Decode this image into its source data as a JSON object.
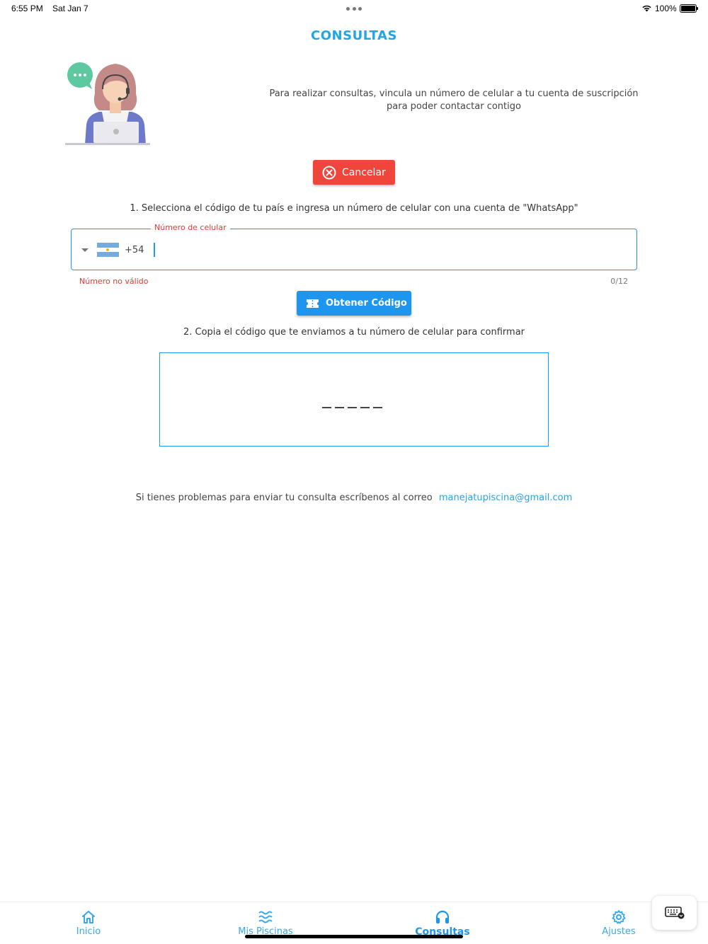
{
  "status_bar": {
    "time": "6:55 PM",
    "date": "Sat Jan 7",
    "battery": "100%"
  },
  "page": {
    "title": "CONSULTAS",
    "intro": "Para realizar consultas, vincula un número de celular a tu cuenta de suscripción para poder contactar contigo"
  },
  "cancel_button": {
    "label": "Cancelar",
    "color": "#f0453a"
  },
  "step1": "1. Selecciona el código de tu país e ingresa un número de celular con una cuenta de \"WhatsApp\"",
  "phone_field": {
    "label": "Número de celular",
    "country_code": "+54",
    "country_flag": "argentina-flag-icon",
    "value": "",
    "error": "Número no válido",
    "counter": "0/12"
  },
  "code_button": {
    "label": "Obtener Código",
    "color": "#1e96f0"
  },
  "step2": "2. Copia el código que te enviamos a tu número de celular para confirmar",
  "help": {
    "text": "Si tienes problemas para enviar tu consulta escríbenos al correo",
    "email": "manejatupiscina@gmail.com"
  },
  "nav": {
    "items": [
      {
        "label": "Inicio",
        "icon": "home-icon"
      },
      {
        "label": "Mis Piscinas",
        "icon": "waves-icon"
      },
      {
        "label": "Consultas",
        "icon": "headset-icon",
        "active": true
      },
      {
        "label": "Ajustes",
        "icon": "gear-icon"
      }
    ]
  },
  "colors": {
    "accent": "#1fa6e8",
    "error": "#e53935",
    "field_border": "#2196f3"
  }
}
